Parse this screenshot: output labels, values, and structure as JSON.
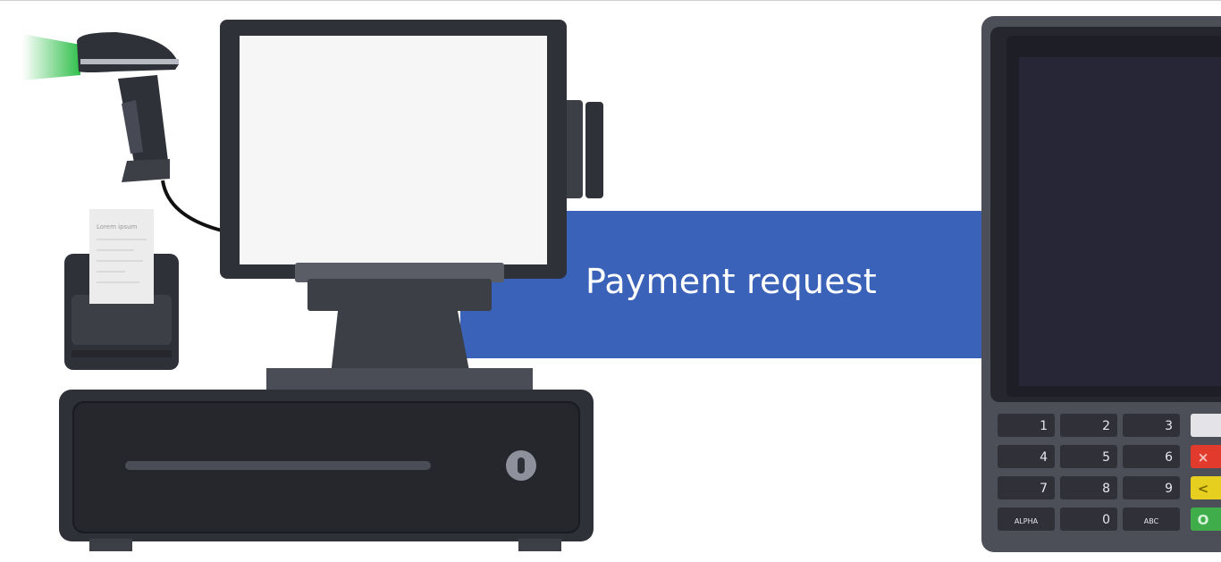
{
  "arrow": {
    "label": "Payment request",
    "color": "#3a62b8"
  },
  "receipt": {
    "title": "Lorem ipsum"
  },
  "terminal": {
    "keys": [
      [
        "1",
        "2",
        "3"
      ],
      [
        "4",
        "5",
        "6"
      ],
      [
        "7",
        "8",
        "9"
      ],
      [
        "ALPHA",
        "0",
        "ABC"
      ]
    ],
    "side_keys": [
      {
        "name": "blank",
        "symbol": "",
        "color": "#e4e4e8"
      },
      {
        "name": "cancel",
        "symbol": "×",
        "color": "#e23b2e"
      },
      {
        "name": "clear",
        "symbol": "<",
        "color": "#e6cf1e"
      },
      {
        "name": "enter",
        "symbol": "O",
        "color": "#3fae4a"
      }
    ]
  },
  "colors": {
    "device_dark": "#2f3138",
    "device_mid": "#3d3f47",
    "screen": "#f6f6f6",
    "terminal_screen": "#262636",
    "scanner_beam": "#2fbf4a"
  }
}
